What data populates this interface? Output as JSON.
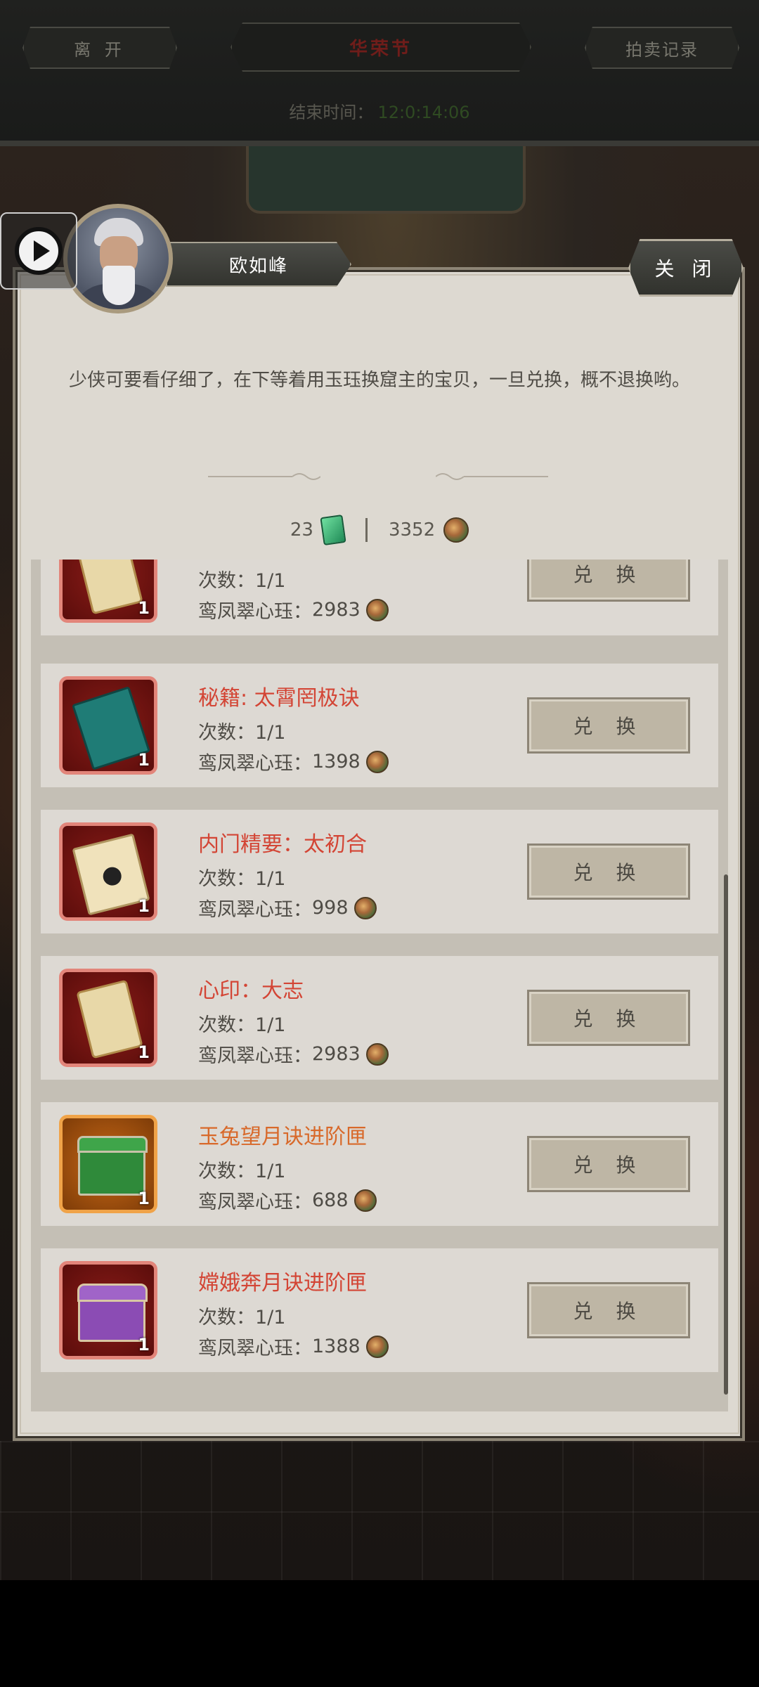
{
  "topbar": {
    "leave_label": "离 开",
    "title": "华荣节",
    "record_label": "拍卖记录",
    "end_time_label": "结束时间：",
    "end_time_value": "12:0:14:06"
  },
  "npc": {
    "name": "欧如峰",
    "close_label": "关 闭",
    "dialog": "少侠可要看仔细了，在下等着用玉珏换窟主的宝贝，一旦兑换，概不退换哟。"
  },
  "currency": {
    "jade_count": "23",
    "coin_count": "3352"
  },
  "items": [
    {
      "title": "",
      "count": "次数：1/1",
      "price_label": "鸾凤翠心珏：",
      "price": "2983",
      "qty": "1",
      "button": "兑 换",
      "icon": "scroll-icon",
      "color": "red"
    },
    {
      "title": "秘籍: 太霄罔极诀",
      "count": "次数：1/1",
      "price_label": "鸾凤翠心珏：",
      "price": "1398",
      "qty": "1",
      "button": "兑 换",
      "icon": "book-teal-icon",
      "color": "red"
    },
    {
      "title": "内门精要：太初合",
      "count": "次数：1/1",
      "price_label": "鸾凤翠心珏：",
      "price": "998",
      "qty": "1",
      "button": "兑 换",
      "icon": "book-cream-icon",
      "color": "red"
    },
    {
      "title": "心印：大志",
      "count": "次数：1/1",
      "price_label": "鸾凤翠心珏：",
      "price": "2983",
      "qty": "1",
      "button": "兑 换",
      "icon": "scroll-icon",
      "color": "red"
    },
    {
      "title": "玉兔望月诀进阶匣",
      "count": "次数：1/1",
      "price_label": "鸾凤翠心珏：",
      "price": "688",
      "qty": "1",
      "button": "兑 换",
      "icon": "chest-green-icon",
      "color": "orange"
    },
    {
      "title": "嫦娥奔月诀进阶匣",
      "count": "次数：1/1",
      "price_label": "鸾凤翠心珏：",
      "price": "1388",
      "qty": "1",
      "button": "兑 换",
      "icon": "chest-purple-icon",
      "color": "red"
    }
  ]
}
